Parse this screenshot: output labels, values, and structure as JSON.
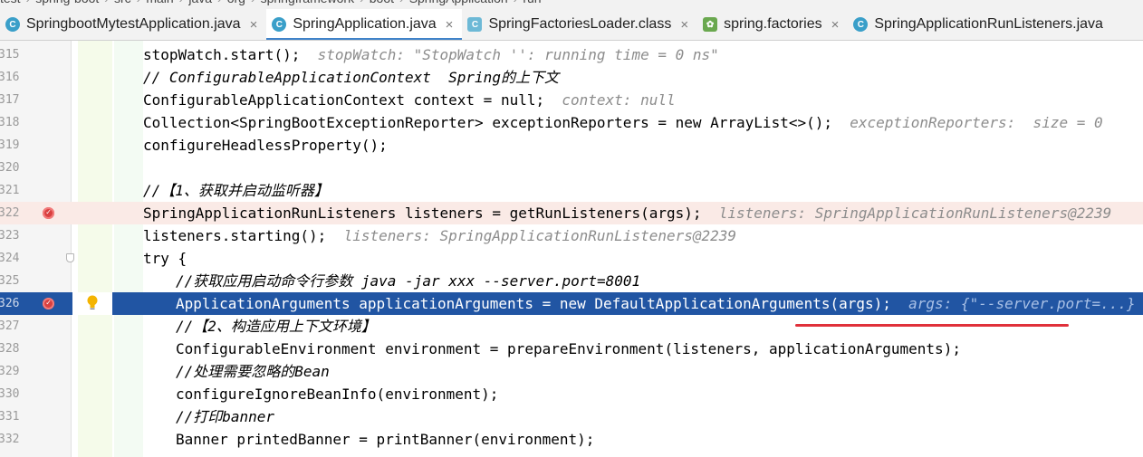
{
  "breadcrumb": [
    "test",
    "spring-boot",
    "src",
    "main",
    "java",
    "org",
    "springframework",
    "boot",
    "SpringApplication",
    "run"
  ],
  "tabs": [
    {
      "label": "SpringbootMytestApplication.java",
      "icon": "java-class-icon",
      "active": false
    },
    {
      "label": "SpringApplication.java",
      "icon": "java-class-icon",
      "active": true
    },
    {
      "label": "SpringFactoriesLoader.class",
      "icon": "class-file-icon",
      "active": false
    },
    {
      "label": "spring.factories",
      "icon": "factories-file-icon",
      "active": false
    },
    {
      "label": "SpringApplicationRunListeners.java",
      "icon": "java-class-icon",
      "active": false
    }
  ],
  "tab_close_glyph": "×",
  "lines": [
    {
      "num": "315",
      "text": "stopWatch.start();",
      "hint": "  stopWatch: \"StopWatch '': running time = 0 ns\""
    },
    {
      "num": "316",
      "text": "// ConfigurableApplicationContext  Spring的上下文"
    },
    {
      "num": "317",
      "text": "ConfigurableApplicationContext context = null;",
      "hint": "  context: null"
    },
    {
      "num": "318",
      "text": "Collection<SpringBootExceptionReporter> exceptionReporters = new ArrayList<>();",
      "hint": "  exceptionReporters:  size = 0"
    },
    {
      "num": "319",
      "text": "configureHeadlessProperty();"
    },
    {
      "num": "320",
      "text": ""
    },
    {
      "num": "321",
      "text": "//【1、获取并启动监听器】"
    },
    {
      "num": "322",
      "text": "SpringApplicationRunListeners listeners = getRunListeners(args);",
      "hint": "  listeners: SpringApplicationRunListeners@2239"
    },
    {
      "num": "323",
      "text": "listeners.starting();",
      "hint": "  listeners: SpringApplicationRunListeners@2239"
    },
    {
      "num": "324",
      "text": "try {"
    },
    {
      "num": "325",
      "text": "//获取应用启动命令行参数 java -jar xxx --server.port=8001"
    },
    {
      "num": "326",
      "text": "ApplicationArguments applicationArguments = new DefaultApplicationArguments(args);",
      "hint": "  args: {\"--server.port=...}"
    },
    {
      "num": "327",
      "text": "//【2、构造应用上下文环境】"
    },
    {
      "num": "328",
      "text": "ConfigurableEnvironment environment = prepareEnvironment(listeners, applicationArguments);"
    },
    {
      "num": "329",
      "text": "//处理需要忽略的Bean"
    },
    {
      "num": "330",
      "text": "configureIgnoreBeanInfo(environment);"
    },
    {
      "num": "331",
      "text": "//打印banner"
    },
    {
      "num": "332",
      "text": "Banner printedBanner = printBanner(environment);"
    }
  ]
}
